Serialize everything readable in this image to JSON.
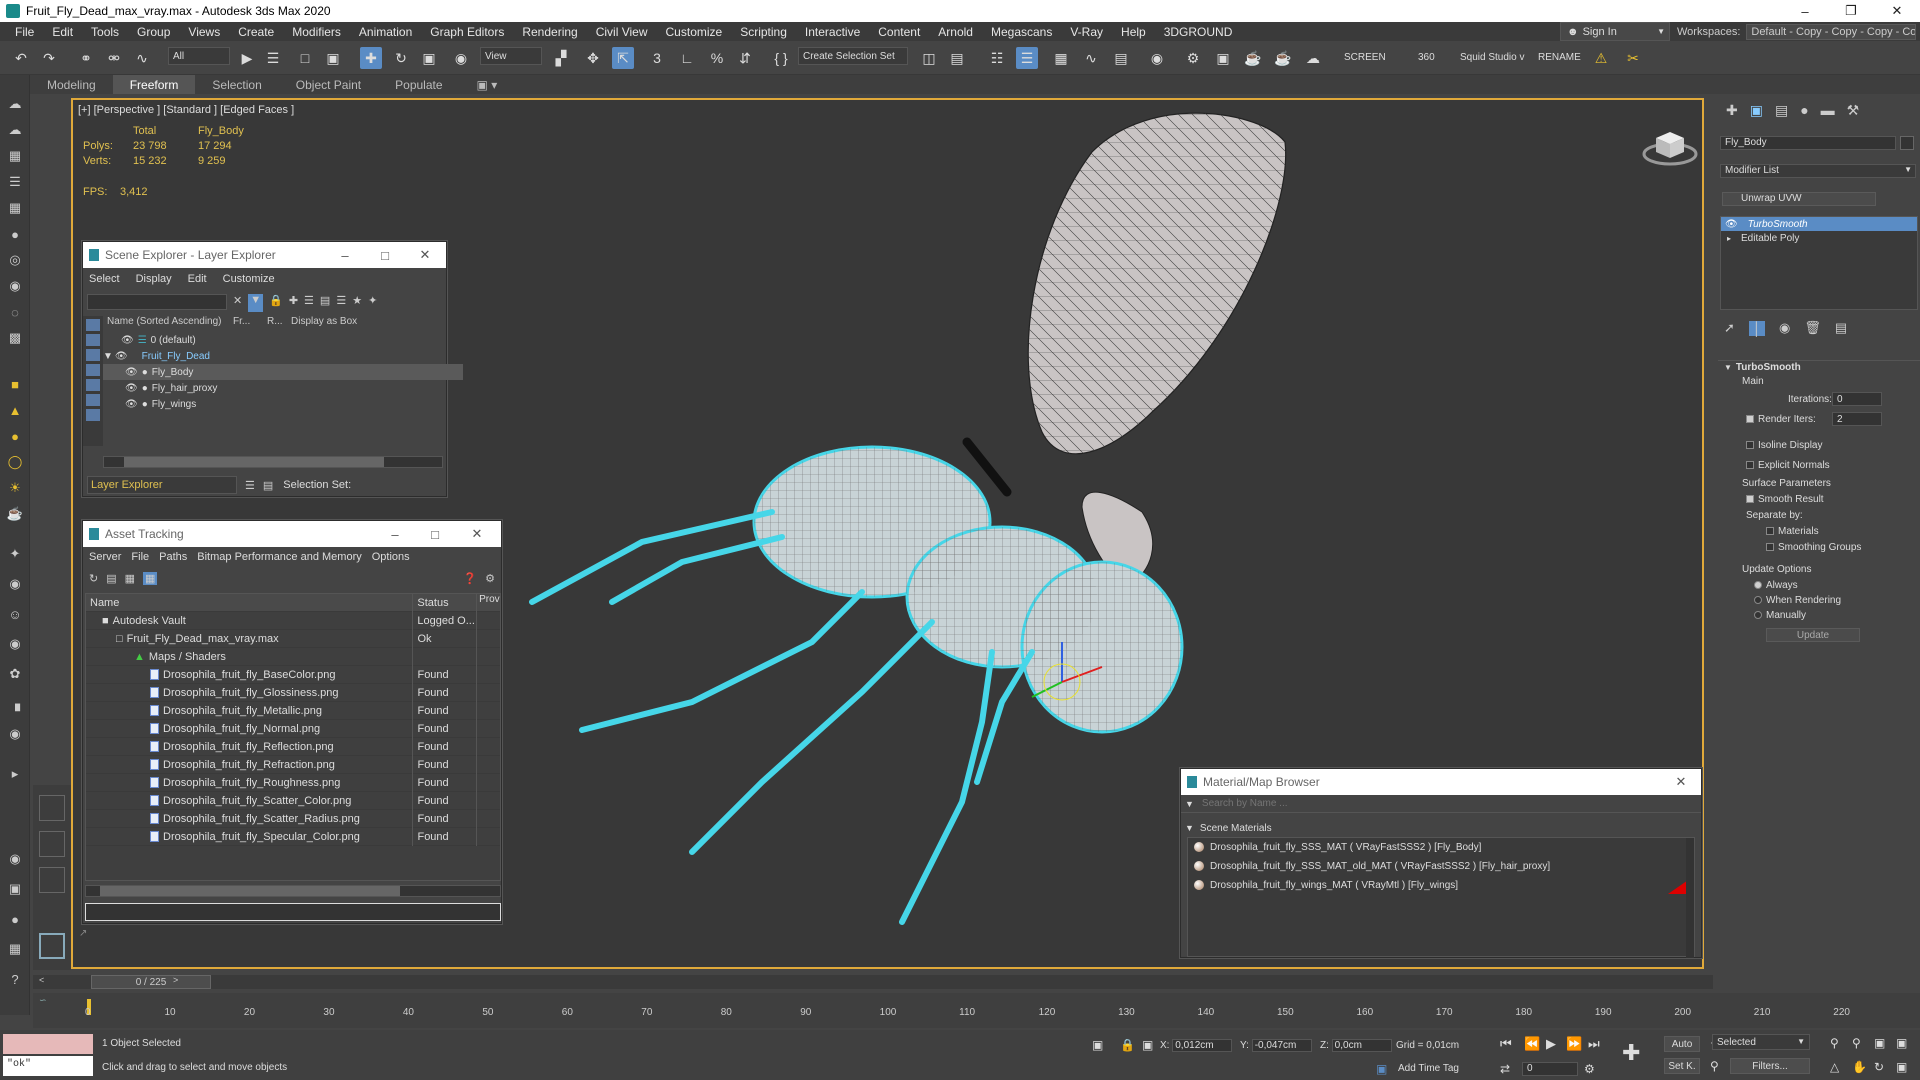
{
  "window": {
    "title": "Fruit_Fly_Dead_max_vray.max - Autodesk 3ds Max 2020"
  },
  "menu": [
    "File",
    "Edit",
    "Tools",
    "Group",
    "Views",
    "Create",
    "Modifiers",
    "Animation",
    "Graph Editors",
    "Rendering",
    "Civil View",
    "Customize",
    "Scripting",
    "Interactive",
    "Content",
    "Arnold",
    "Megascans",
    "V-Ray",
    "Help",
    "3DGROUND"
  ],
  "signin": "Sign In",
  "workspaces": {
    "label": "Workspaces:",
    "value": "Default - Copy - Copy - Copy - Copy"
  },
  "toolbar": {
    "filter": "All",
    "view": "View",
    "selection_set": "Create Selection Set",
    "screen": "SCREEN",
    "num360": "360",
    "squid": "Squid Studio v",
    "rename": "RENAME"
  },
  "ribbon": {
    "tabs": [
      "Modeling",
      "Freeform",
      "Selection",
      "Object Paint",
      "Populate"
    ],
    "active": "Freeform"
  },
  "viewport": {
    "label": "[+] [Perspective ] [Standard ] [Edged Faces ]",
    "stats_header": [
      "",
      "Total",
      "Fly_Body"
    ],
    "polys": [
      "Polys:",
      "23 798",
      "17 294"
    ],
    "verts": [
      "Verts:",
      "15 232",
      "9 259"
    ],
    "fps_label": "FPS:",
    "fps": "3,412"
  },
  "scene_explorer": {
    "title": "Scene Explorer - Layer Explorer",
    "menu": [
      "Select",
      "Display",
      "Edit",
      "Customize"
    ],
    "columns": [
      "Name (Sorted Ascending)",
      "Fr...",
      "R...",
      "Display as Box"
    ],
    "rows": [
      "0 (default)",
      "Fruit_Fly_Dead",
      "Fly_Body",
      "Fly_hair_proxy",
      "Fly_wings"
    ],
    "footer_layer": "Layer Explorer",
    "footer_selset": "Selection Set:"
  },
  "asset_tracking": {
    "title": "Asset Tracking",
    "menu": [
      "Server",
      "File",
      "Paths",
      "Bitmap Performance and Memory",
      "Options"
    ],
    "columns": [
      "Name",
      "Status",
      "Prov"
    ],
    "rows": [
      {
        "name": "Autodesk Vault",
        "status": "Logged O..."
      },
      {
        "name": "Fruit_Fly_Dead_max_vray.max",
        "status": "Ok"
      },
      {
        "name": "Maps / Shaders",
        "status": ""
      },
      {
        "name": "Drosophila_fruit_fly_BaseColor.png",
        "status": "Found"
      },
      {
        "name": "Drosophila_fruit_fly_Glossiness.png",
        "status": "Found"
      },
      {
        "name": "Drosophila_fruit_fly_Metallic.png",
        "status": "Found"
      },
      {
        "name": "Drosophila_fruit_fly_Normal.png",
        "status": "Found"
      },
      {
        "name": "Drosophila_fruit_fly_Reflection.png",
        "status": "Found"
      },
      {
        "name": "Drosophila_fruit_fly_Refraction.png",
        "status": "Found"
      },
      {
        "name": "Drosophila_fruit_fly_Roughness.png",
        "status": "Found"
      },
      {
        "name": "Drosophila_fruit_fly_Scatter_Color.png",
        "status": "Found"
      },
      {
        "name": "Drosophila_fruit_fly_Scatter_Radius.png",
        "status": "Found"
      },
      {
        "name": "Drosophila_fruit_fly_Specular_Color.png",
        "status": "Found"
      }
    ]
  },
  "material_browser": {
    "title": "Material/Map Browser",
    "search_placeholder": "Search by Name ...",
    "section": "Scene Materials",
    "items": [
      "Drosophila_fruit_fly_SSS_MAT  ( VRayFastSSS2 )  [Fly_Body]",
      "Drosophila_fruit_fly_SSS_MAT_old_MAT  ( VRayFastSSS2 )  [Fly_hair_proxy]",
      "Drosophila_fruit_fly_wings_MAT  ( VRayMtl )  [Fly_wings]"
    ]
  },
  "command_panel": {
    "object_name": "Fly_Body",
    "modifier_list": "Modifier List",
    "unwrap": "Unwrap UVW",
    "stack": [
      "TurboSmooth",
      "Editable Poly"
    ],
    "rollout": "TurboSmooth",
    "main": "Main",
    "iterations_label": "Iterations:",
    "iterations": "0",
    "render_iters_label": "Render Iters:",
    "render_iters": "2",
    "isoline": "Isoline Display",
    "explicit": "Explicit Normals",
    "surface": "Surface Parameters",
    "smooth_result": "Smooth Result",
    "separate_by": "Separate by:",
    "materials": "Materials",
    "smoothing_groups": "Smoothing Groups",
    "update_options": "Update Options",
    "always": "Always",
    "when_rendering": "When Rendering",
    "manually": "Manually",
    "update": "Update"
  },
  "timeline": {
    "frame": "0 / 225",
    "ticks": [
      "0",
      "10",
      "20",
      "30",
      "40",
      "50",
      "60",
      "70",
      "80",
      "90",
      "100",
      "110",
      "120",
      "130",
      "140",
      "150",
      "160",
      "170",
      "180",
      "190",
      "200",
      "210",
      "220"
    ]
  },
  "status": {
    "maxscript": "\"ok\"",
    "selected": "1 Object Selected",
    "hint": "Click and drag to select and move objects",
    "x": "0,012cm",
    "y": "-0,047cm",
    "z": "0,0cm",
    "grid": "Grid = 0,01cm",
    "add_time_tag": "Add Time Tag",
    "auto": "Auto",
    "selected_dd": "Selected",
    "set_k": "Set K.",
    "filters": "Filters...",
    "frame_field": "0"
  }
}
